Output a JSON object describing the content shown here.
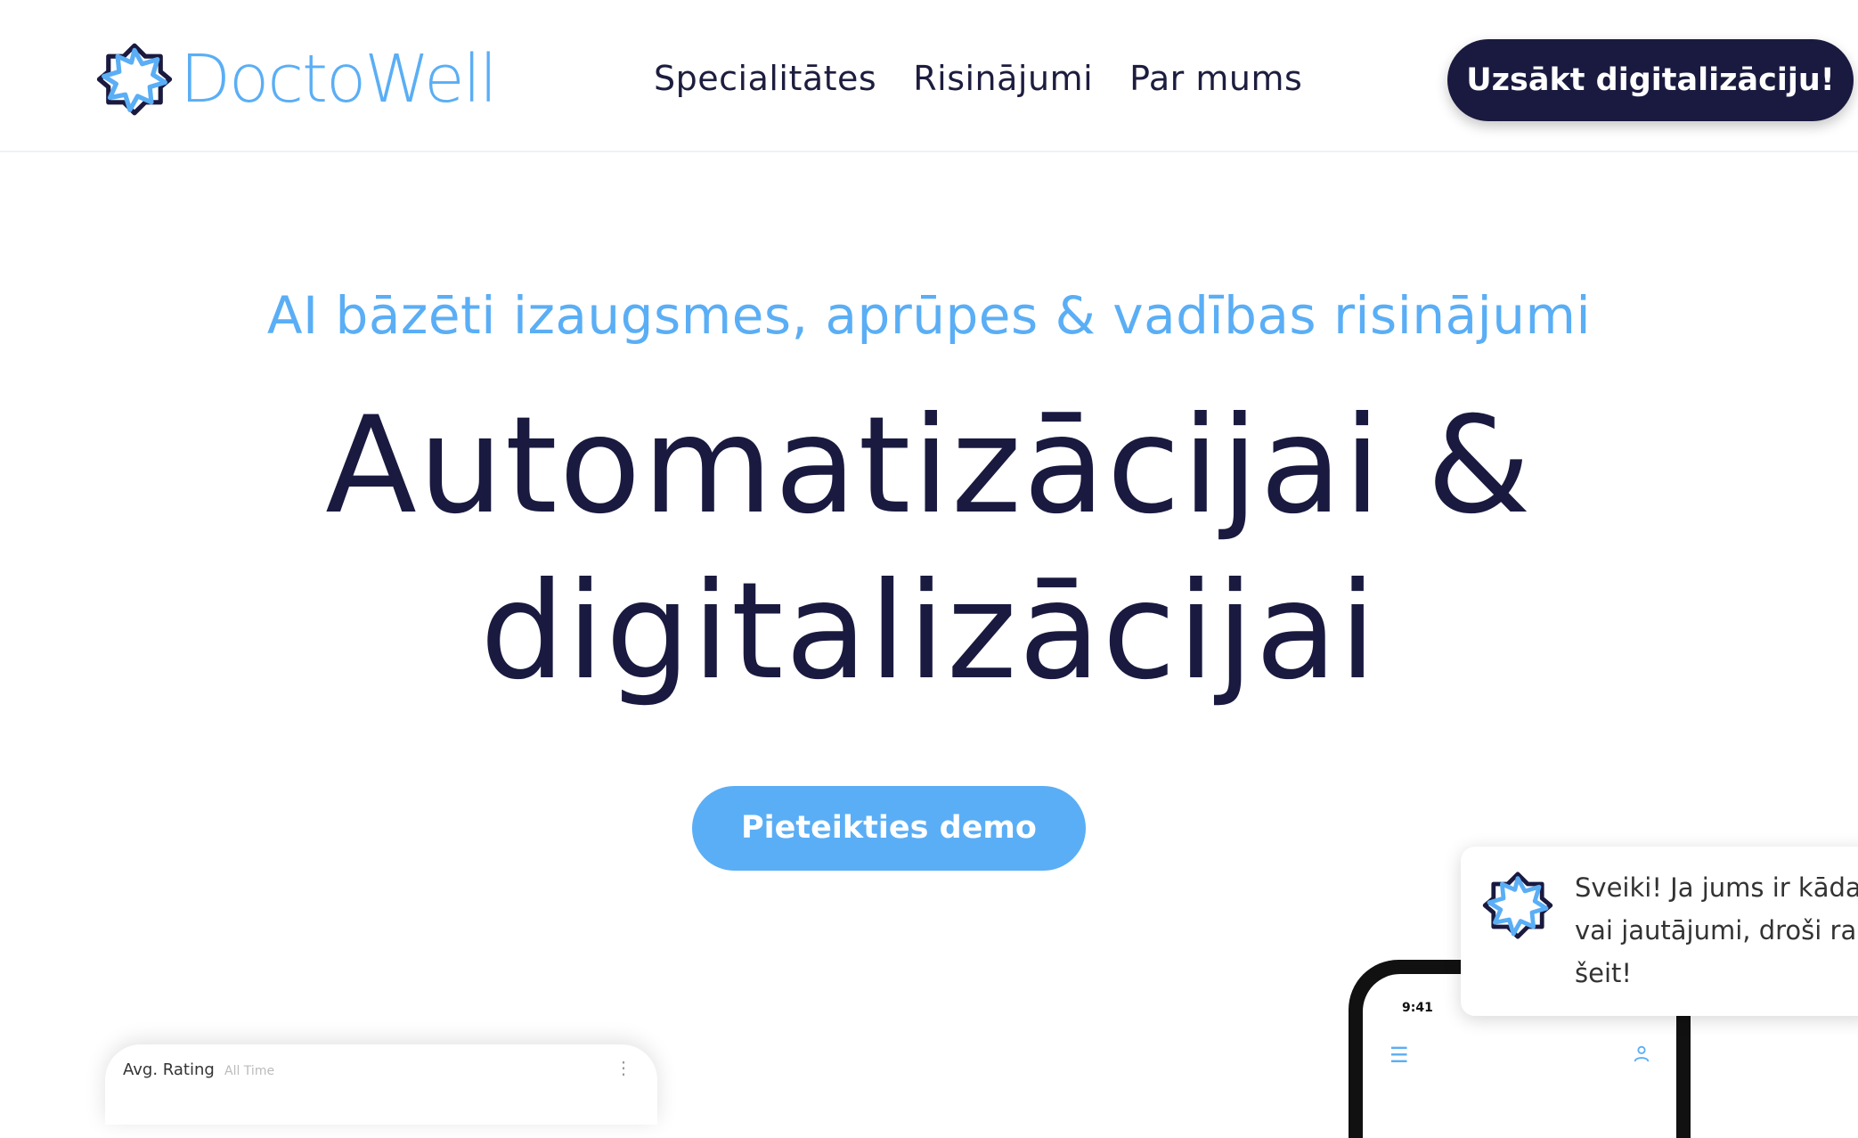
{
  "header": {
    "logo_text": "DoctoWell",
    "nav": [
      "Specialitātes",
      "Risinājumi",
      "Par mums"
    ],
    "cta_label": "Uzsākt digitalizāciju!"
  },
  "hero": {
    "subtitle": "AI bāzēti izaugsmes, aprūpes & vadības risinājumi",
    "headline_line1": "Automatizācijai &",
    "headline_line2": "digitalizācijai",
    "demo_label": "Pieteikties demo"
  },
  "dashboard_card": {
    "title": "Avg. Rating",
    "filter": "All Time",
    "menu_icon": "more-vertical-icon"
  },
  "phone": {
    "time": "9:41",
    "menu_icon": "hamburger-icon",
    "user_icon": "user-icon"
  },
  "chat": {
    "lines": [
      "Sveiki! Ja jums ir kāda",
      "vai jautājumi, droši rak",
      "šeit!"
    ]
  },
  "colors": {
    "brand_dark": "#1a1a40",
    "brand_blue": "#5aaef5"
  }
}
